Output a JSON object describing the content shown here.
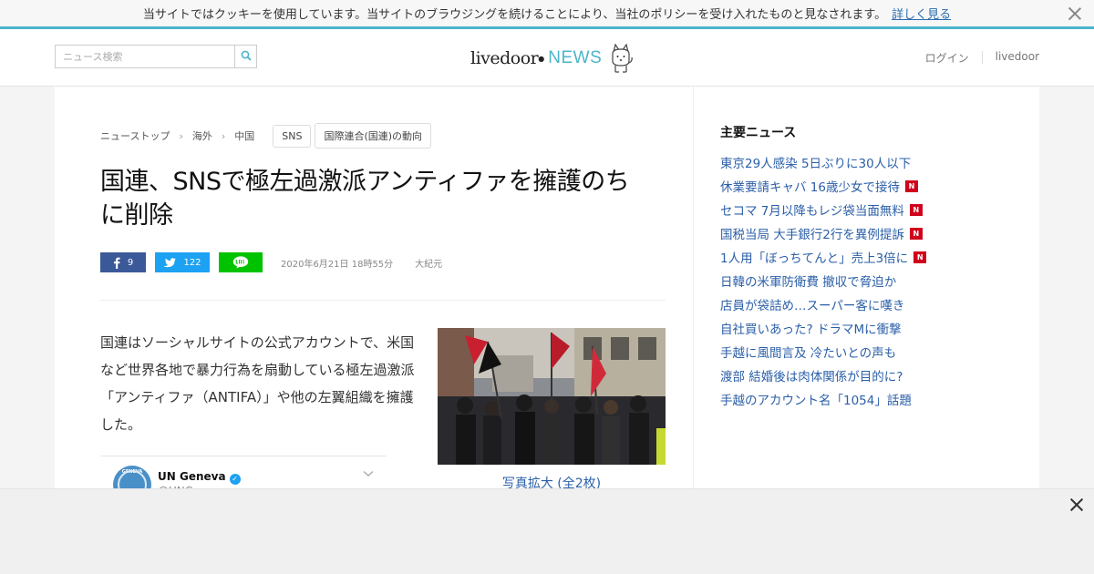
{
  "cookie_bar": {
    "message": "当サイトではクッキーを使用しています。当サイトのブラウジングを続けることにより、当社のポリシーを受け入れたものと見なされます。",
    "link": "詳しく見る"
  },
  "header": {
    "search_placeholder": "ニュース検索",
    "logo_primary": "livedoor",
    "logo_secondary": "NEWS",
    "login": "ログイン",
    "livedoor_link": "livedoor"
  },
  "breadcrumb": {
    "items": [
      "ニューストップ",
      "海外",
      "中国"
    ],
    "tags": [
      "SNS",
      "国際連合(国連)の動向"
    ]
  },
  "article": {
    "title": "国連、SNSで極左過激派アンティファを擁護のちに削除",
    "share": {
      "facebook_count": "9",
      "twitter_count": "122"
    },
    "date": "2020年6月21日 18時55分",
    "source": "大紀元",
    "body": "国連はソーシャルサイトの公式アカウントで、米国など世界各地で暴力行為を扇動している極左過激派「アンティファ（ANTIFA）」や他の左翼組織を擁護した。",
    "embed": {
      "name": "UN Geneva",
      "handle": "@UNGeneva"
    },
    "photo_caption": "写真拡大 (全2枚)"
  },
  "sidebar": {
    "title": "主要ニュース",
    "news": [
      {
        "text": "東京29人感染 5日ぶりに30人以下",
        "new": false
      },
      {
        "text": "休業要請キャバ 16歳少女で接待",
        "new": true
      },
      {
        "text": "セコマ 7月以降もレジ袋当面無料",
        "new": true
      },
      {
        "text": "国税当局 大手銀行2行を異例提訴",
        "new": true
      },
      {
        "text": "1人用「ぼっちてんと」売上3倍に",
        "new": true
      },
      {
        "text": "日韓の米軍防衛費 撤収で脅迫か",
        "new": false
      },
      {
        "text": "店員が袋詰め…スーパー客に嘆き",
        "new": false
      },
      {
        "text": "自社買いあった? ドラマMに衝撃",
        "new": false
      },
      {
        "text": "手越に風間言及 冷たいとの声も",
        "new": false
      },
      {
        "text": "渡部 結婚後は肉体関係が目的に?",
        "new": false
      },
      {
        "text": "手越のアカウント名「1054」話題",
        "new": false
      }
    ],
    "new_badge": "N"
  },
  "colors": {
    "accent": "#4db4cc",
    "link": "#2b5fa8",
    "facebook": "#3b5998",
    "twitter": "#1da1f2",
    "line": "#00c300",
    "new_badge": "#d0021b"
  }
}
